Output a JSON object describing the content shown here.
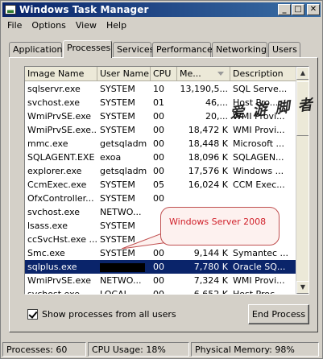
{
  "window": {
    "title": "Windows Task Manager"
  },
  "titlebar_buttons": {
    "minimize": "_",
    "maximize": "□",
    "close": "✕"
  },
  "menu": [
    "File",
    "Options",
    "View",
    "Help"
  ],
  "tabs": [
    {
      "label": "Applications",
      "active": false
    },
    {
      "label": "Processes",
      "active": true
    },
    {
      "label": "Services",
      "active": false
    },
    {
      "label": "Performance",
      "active": false
    },
    {
      "label": "Networking",
      "active": false
    },
    {
      "label": "Users",
      "active": false
    }
  ],
  "columns": [
    "Image Name",
    "User Name",
    "CPU",
    "Me...",
    "Description"
  ],
  "processes": [
    {
      "image": "sqlservr.exe",
      "user": "SYSTEM",
      "cpu": "10",
      "mem": "13,190,5...",
      "desc": "SQL Serve..."
    },
    {
      "image": "svchost.exe",
      "user": "SYSTEM",
      "cpu": "01",
      "mem": "46,...",
      "desc": "Host Pro..."
    },
    {
      "image": "WmiPrvSE.exe",
      "user": "SYSTEM",
      "cpu": "00",
      "mem": "20,...",
      "desc": "WMI Provi..."
    },
    {
      "image": "WmiPrvSE.exe...",
      "user": "SYSTEM",
      "cpu": "00",
      "mem": "18,472 K",
      "desc": "WMI Provi..."
    },
    {
      "image": "mmc.exe",
      "user": "getsqladm",
      "cpu": "00",
      "mem": "18,448 K",
      "desc": "Microsoft ..."
    },
    {
      "image": "SQLAGENT.EXE",
      "user": "exoa",
      "cpu": "00",
      "mem": "18,096 K",
      "desc": "SQLAGEN..."
    },
    {
      "image": "explorer.exe",
      "user": "getsqladm",
      "cpu": "00",
      "mem": "17,576 K",
      "desc": "Windows ..."
    },
    {
      "image": "CcmExec.exe",
      "user": "SYSTEM",
      "cpu": "05",
      "mem": "16,024 K",
      "desc": "CCM Exec..."
    },
    {
      "image": "OfxController...",
      "user": "SYSTEM",
      "cpu": "00",
      "mem": "",
      "desc": ""
    },
    {
      "image": "svchost.exe",
      "user": "NETWO...",
      "cpu": "",
      "mem": "",
      "desc": ""
    },
    {
      "image": "lsass.exe",
      "user": "SYSTEM",
      "cpu": "",
      "mem": "",
      "desc": ""
    },
    {
      "image": "ccSvcHst.exe ...",
      "user": "SYSTEM",
      "cpu": "",
      "mem": "",
      "desc": ""
    },
    {
      "image": "Smc.exe",
      "user": "SYSTEM",
      "cpu": "00",
      "mem": "9,144 K",
      "desc": "Symantec ..."
    },
    {
      "image": "sqlplus.exe",
      "user": "",
      "cpu": "00",
      "mem": "7,780 K",
      "desc": "Oracle SQ...",
      "selected": true,
      "redacted_user": true
    },
    {
      "image": "WmiPrvSE.exe",
      "user": "NETWO...",
      "cpu": "00",
      "mem": "7,324 K",
      "desc": "WMI Provi..."
    },
    {
      "image": "svchost.exe",
      "user": "LOCAL ...",
      "cpu": "00",
      "mem": "6,652 K",
      "desc": "Host Proc..."
    }
  ],
  "show_all": {
    "label": "Show processes from all users",
    "checked": true
  },
  "end_process": {
    "label": "End Process"
  },
  "status": {
    "processes": "Processes: 60",
    "cpu": "CPU Usage: 18%",
    "memory": "Physical Memory: 98%"
  },
  "callout": {
    "text": "Windows Server 2008",
    "color": "#d0202a"
  },
  "watermark": {
    "text": "爱 游 脚 者"
  }
}
